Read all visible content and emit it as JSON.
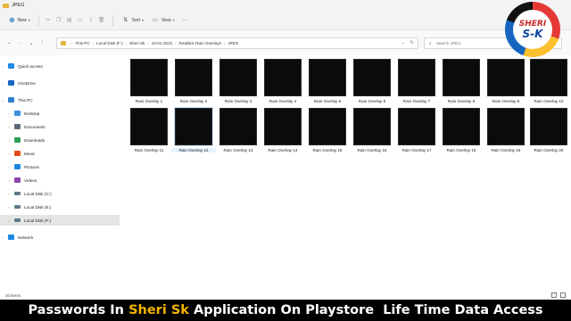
{
  "window": {
    "title": "JPEG"
  },
  "toolbar": {
    "new_label": "New",
    "sort_label": "Sort",
    "view_label": "View",
    "more_label": "···"
  },
  "nav": {
    "back": "←",
    "forward": "→",
    "recent": "⌄",
    "up": "↑"
  },
  "breadcrumb": [
    "This PC",
    "Local Disk (F:)",
    "Sheri Sk",
    "13-01-2022",
    "Realistic Rain Overlays",
    "JPEG"
  ],
  "search": {
    "placeholder": "Search JPEG"
  },
  "sidebar": {
    "items": [
      {
        "label": "Quick access",
        "icon": "star-icon",
        "color": "#1e88e5"
      },
      {
        "label": "OneDrive",
        "icon": "cloud-icon",
        "color": "#1565c0"
      },
      {
        "label": "This PC",
        "icon": "computer-icon",
        "color": "#2f7fd0"
      },
      {
        "label": "Desktop",
        "icon": "desktop-icon",
        "color": "#3d8fe0"
      },
      {
        "label": "Documents",
        "icon": "documents-icon",
        "color": "#5f6b7a"
      },
      {
        "label": "Downloads",
        "icon": "download-icon",
        "color": "#2e9d57"
      },
      {
        "label": "Music",
        "icon": "music-icon",
        "color": "#e64a19"
      },
      {
        "label": "Pictures",
        "icon": "pictures-icon",
        "color": "#1e88e5"
      },
      {
        "label": "Videos",
        "icon": "videos-icon",
        "color": "#8e44ad"
      },
      {
        "label": "Local Disk (C:)",
        "icon": "drive-icon",
        "color": "#607d8b"
      },
      {
        "label": "Local Disk (E:)",
        "icon": "drive-icon",
        "color": "#607d8b"
      },
      {
        "label": "Local Disk (F:)",
        "icon": "drive-icon",
        "color": "#607d8b"
      },
      {
        "label": "Network",
        "icon": "network-icon",
        "color": "#1e88e5"
      }
    ]
  },
  "files": [
    "Rain Overlay 1",
    "Rain Overlay 2",
    "Rain Overlay 3",
    "Rain Overlay 4",
    "Rain Overlay 5",
    "Rain Overlay 6",
    "Rain Overlay 7",
    "Rain Overlay 8",
    "Rain Overlay 9",
    "Rain Overlay 10",
    "Rain Overlay 11",
    "Rain Overlay 12",
    "Rain Overlay 13",
    "Rain Overlay 14",
    "Rain Overlay 15",
    "Rain Overlay 16",
    "Rain Overlay 17",
    "Rain Overlay 18",
    "Rain Overlay 19",
    "Rain Overlay 20"
  ],
  "status": {
    "count": "20 items"
  },
  "logo": {
    "line1": "SHERI",
    "line2": "S-K"
  },
  "banner": {
    "part1": "Passwords In ",
    "highlight": "Sheri Sk",
    "part2": " Application On Playstore  Life Time Data Access"
  },
  "colors": {
    "accent": "#0063b1",
    "banner_highlight": "#f5b400",
    "folder": "#e8b53c"
  }
}
